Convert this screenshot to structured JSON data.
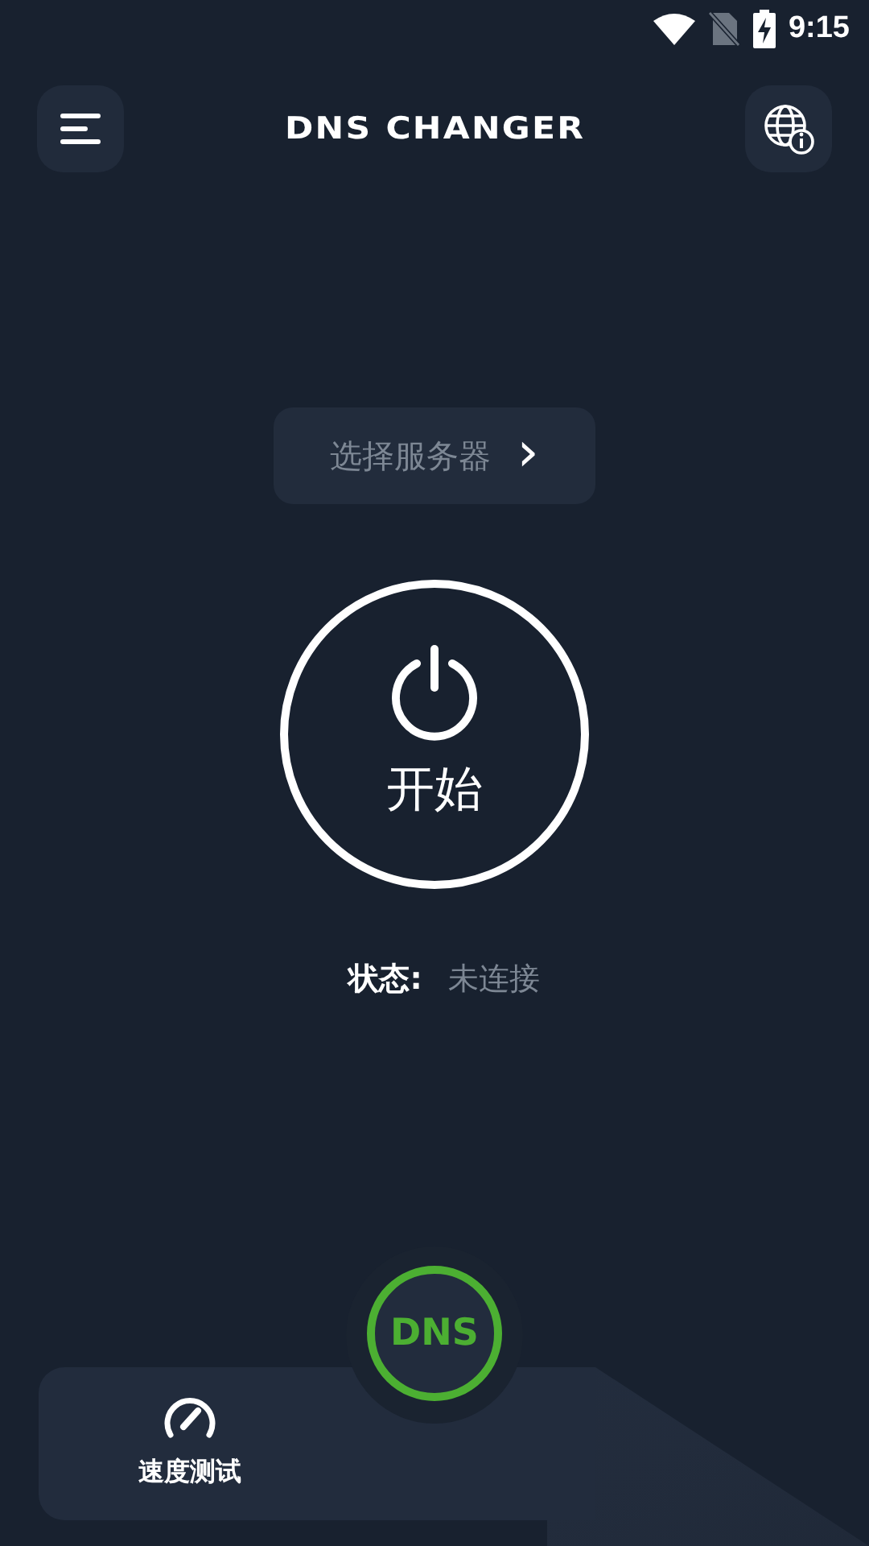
{
  "status_bar": {
    "time": "9:15"
  },
  "header": {
    "title": "DNS CHANGER"
  },
  "server_button": {
    "label": "选择服务器",
    "arrow": "›"
  },
  "power_button": {
    "label": "开始"
  },
  "status": {
    "label": "状态:",
    "value": "未连接"
  },
  "bottom_bar": {
    "logo": "DNS",
    "items": [
      {
        "label": "速度测试"
      }
    ]
  }
}
